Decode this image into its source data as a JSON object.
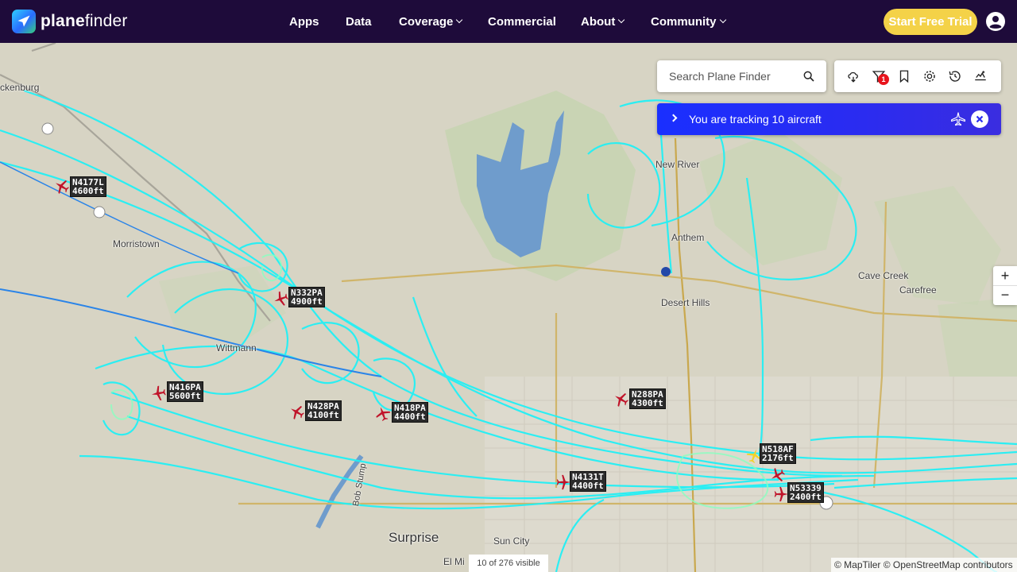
{
  "header": {
    "logo_text_a": "plane",
    "logo_text_b": "finder",
    "nav": {
      "apps": "Apps",
      "data": "Data",
      "coverage": "Coverage",
      "commercial": "Commercial",
      "about": "About",
      "community": "Community"
    },
    "trial_button": "Start Free Trial"
  },
  "search": {
    "placeholder": "Search Plane Finder"
  },
  "toolbar": {
    "filter_badge": "1"
  },
  "tracking": {
    "text": "You are tracking 10 aircraft"
  },
  "zoom": {
    "in": "+",
    "out": "−"
  },
  "map": {
    "places": {
      "wickenburg": "ckenburg",
      "morristown": "Morristown",
      "wittmann": "Wittmann",
      "new_river": "New River",
      "anthem": "Anthem",
      "desert_hills": "Desert Hills",
      "cave_creek": "Cave Creek",
      "carefree": "Carefree",
      "surprise": "Surprise",
      "sun_city": "Sun City",
      "el_mirage": "El Mi",
      "bob_stump": "Bob Stump"
    },
    "aircraft": [
      {
        "callsign": "N4177L",
        "altitude": "4600ft"
      },
      {
        "callsign": "N332PA",
        "altitude": "4900ft"
      },
      {
        "callsign": "N416PA",
        "altitude": "5600ft"
      },
      {
        "callsign": "N428PA",
        "altitude": "4100ft"
      },
      {
        "callsign": "N418PA",
        "altitude": "4400ft"
      },
      {
        "callsign": "N288PA",
        "altitude": "4300ft"
      },
      {
        "callsign": "N518AF",
        "altitude": "2176ft"
      },
      {
        "callsign": "N4131T",
        "altitude": "4400ft"
      },
      {
        "callsign": "N53339",
        "altitude": "2400ft"
      }
    ]
  },
  "footer": {
    "visible_count": "10 of 276 visible",
    "attribution": "© MapTiler © OpenStreetMap contributors"
  }
}
